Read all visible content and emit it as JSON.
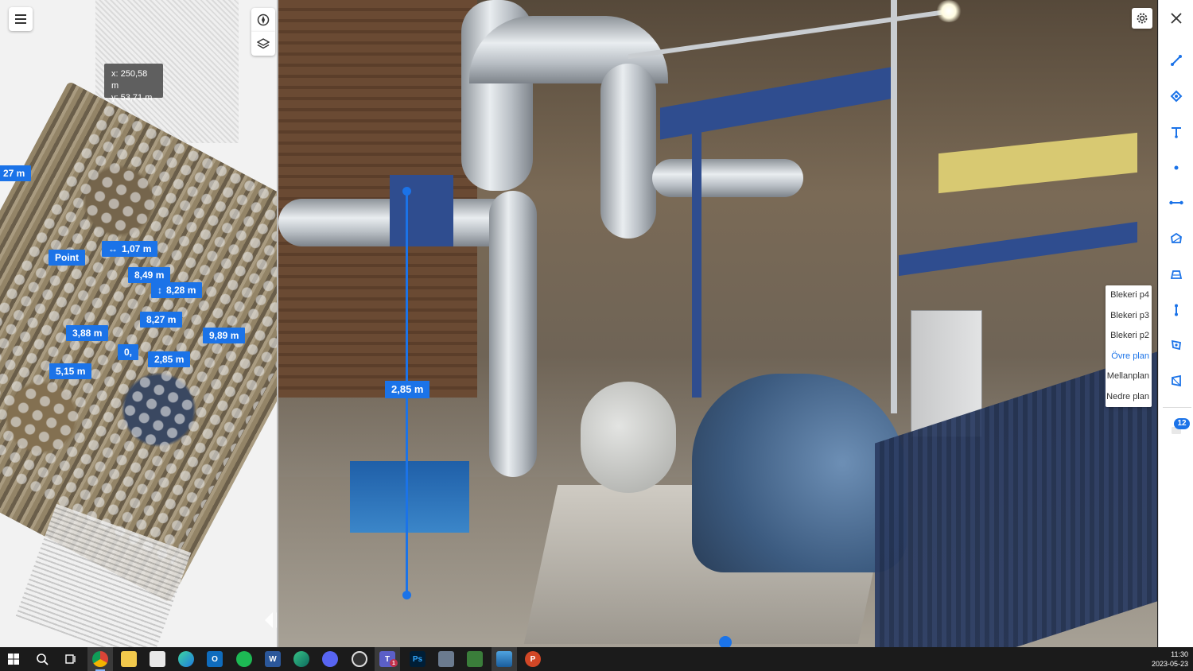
{
  "map": {
    "coordinates": {
      "x_label": "x: 250,58 m",
      "y_label": "y: 53,71 m"
    },
    "measurements": [
      {
        "label": "27 m",
        "icon": "none"
      },
      {
        "label": "1,07 m",
        "icon": "horizontal-arrow-icon"
      },
      {
        "label": "Point",
        "icon": "none"
      },
      {
        "label": "8,49 m",
        "icon": "none"
      },
      {
        "label": "8,28 m",
        "icon": "vertical-arrow-icon"
      },
      {
        "label": "8,27 m",
        "icon": "none"
      },
      {
        "label": "3,88 m",
        "icon": "none"
      },
      {
        "label": "9,89 m",
        "icon": "none"
      },
      {
        "label": "0,",
        "icon": "none"
      },
      {
        "label": "2,85 m",
        "icon": "none"
      },
      {
        "label": "5,15 m",
        "icon": "none"
      }
    ],
    "buttons": {
      "menu": "menu-icon",
      "compass": "compass-icon",
      "layers": "layers-icon"
    }
  },
  "panorama": {
    "vertical_measurement": "2,85 m",
    "floor_levels": [
      "Blekeri p4",
      "Blekeri p3",
      "Blekeri p2",
      "Övre plan",
      "Mellanplan",
      "Nedre plan"
    ],
    "active_floor": "Övre plan"
  },
  "toolbar": {
    "tools": [
      "close-icon",
      "line-measure-icon",
      "area-measure-icon",
      "height-measure-icon",
      "point-icon",
      "distance-icon",
      "polygon-icon",
      "volume-icon",
      "vertical-measure-icon",
      "clip-box-icon",
      "clip-plane-icon",
      "comments-icon"
    ],
    "comments_count": "12"
  },
  "taskbar": {
    "apps": [
      "windows-start-icon",
      "search-icon",
      "task-view-icon",
      "chrome-icon",
      "file-explorer-icon",
      "store-icon",
      "edge-icon",
      "outlook-icon",
      "spotify-icon",
      "word-icon",
      "edge-dev-icon",
      "discord-icon",
      "media-player-icon",
      "teams-icon",
      "photoshop-icon",
      "calculator-icon",
      "project-icon",
      "photos-icon",
      "powerpoint-icon"
    ],
    "teams_badge": "1",
    "time": "11:30",
    "date": "2023-05-23"
  },
  "colors": {
    "accent": "#1b73e8",
    "taskbar": "#1b1b1b"
  }
}
